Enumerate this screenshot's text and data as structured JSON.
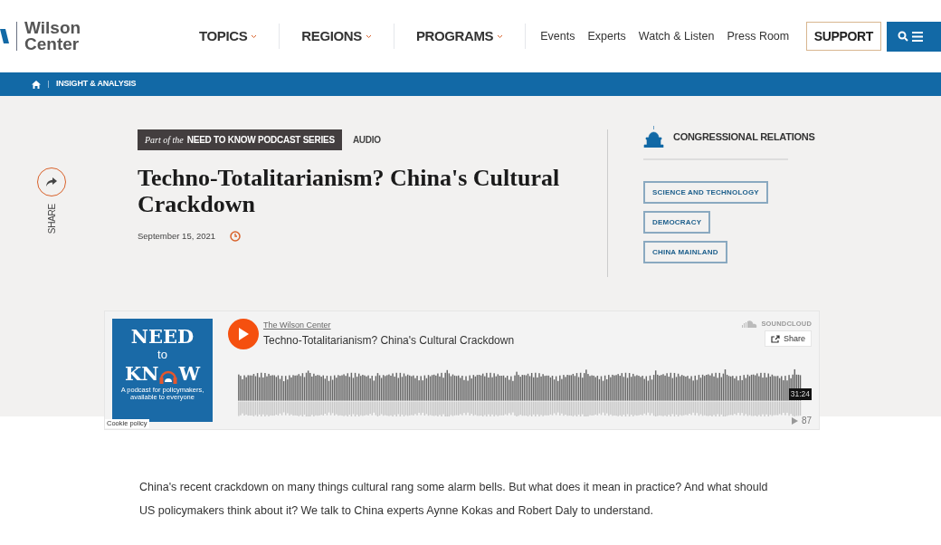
{
  "logo": {
    "name": "Wilson\nCenter"
  },
  "nav": {
    "menus": [
      {
        "label": "TOPICS"
      },
      {
        "label": "REGIONS"
      },
      {
        "label": "PROGRAMS"
      }
    ],
    "links": [
      "Events",
      "Experts",
      "Watch & Listen",
      "Press Room"
    ],
    "support": "SUPPORT"
  },
  "breadcrumb": [
    "INSIGHT & ANALYSIS"
  ],
  "article": {
    "series_prefix": "Part of the",
    "series": "NEED TO KNOW PODCAST SERIES",
    "type": "AUDIO",
    "title": "Techno-Totalitarianism? China's Cultural Crackdown",
    "date": "September 15, 2021",
    "share": "SHARE"
  },
  "program": "CONGRESSIONAL RELATIONS",
  "tags": [
    "SCIENCE AND TECHNOLOGY",
    "DEMOCRACY",
    "CHINA MAINLAND"
  ],
  "player": {
    "cover": {
      "line1": "NEED",
      "line2": "to",
      "line3a": "KN",
      "line3b": "W",
      "tagline": "A podcast for policymakers, available to everyone"
    },
    "user": "The Wilson Center",
    "track": "Techno-Totalitarianism? China's Cultural Crackdown",
    "brand": "SOUNDCLOUD",
    "share": "Share",
    "duration": "31:24",
    "plays": "87",
    "cookie": "Cookie policy"
  },
  "body": "China's recent crackdown on many things cultural rang some alarm bells. But what does it mean in practice? And what should US policymakers think about it? We talk to China experts Aynne Kokas and Robert Daly to understand."
}
